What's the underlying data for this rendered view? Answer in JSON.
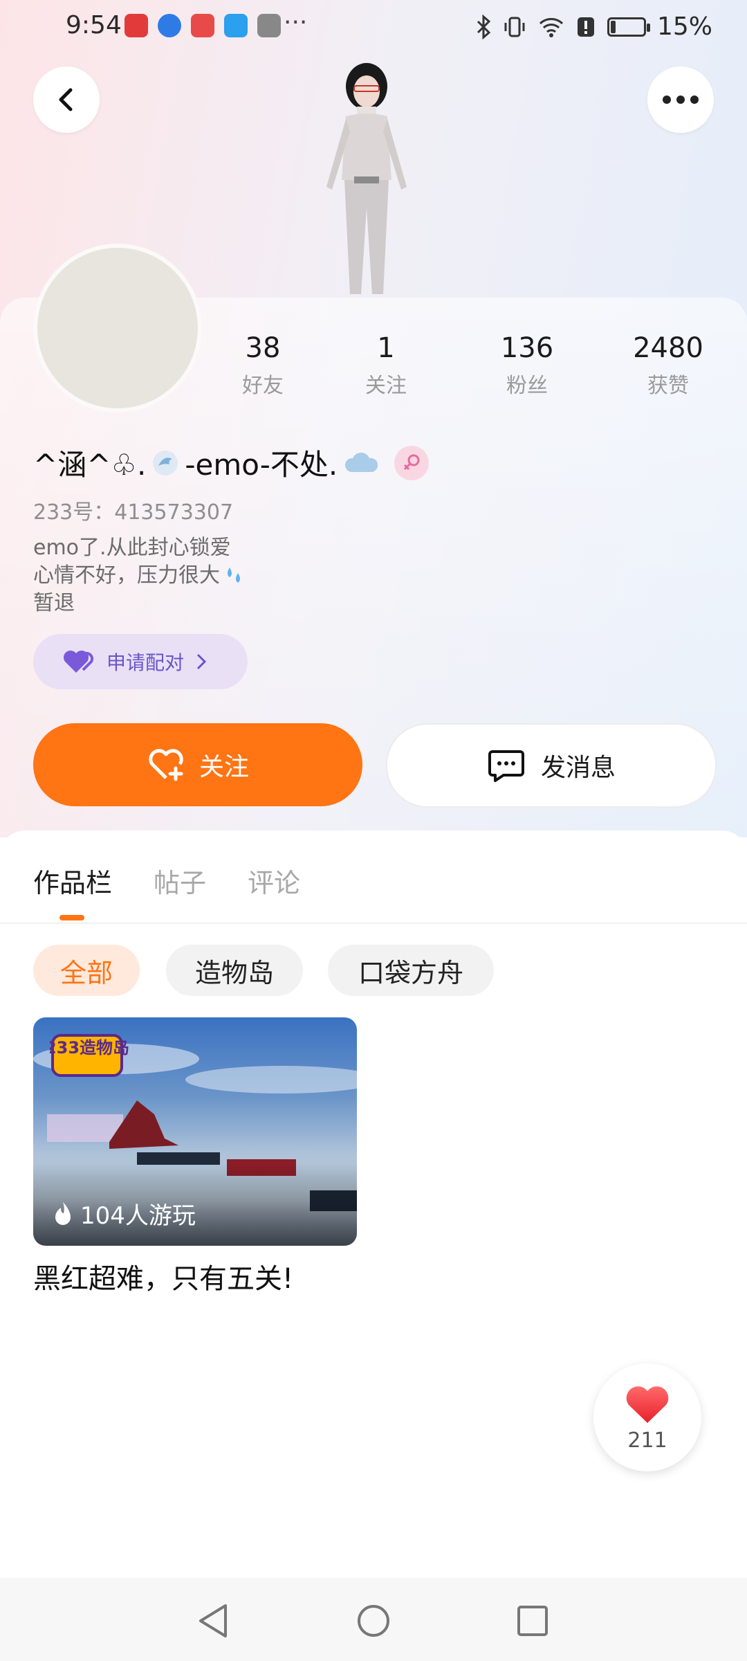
{
  "status_bar": {
    "time": "9:54",
    "dots": "···",
    "battery": "15%",
    "battery_level": 0.15
  },
  "profile": {
    "stats": [
      {
        "value": "38",
        "label": "好友"
      },
      {
        "value": "1",
        "label": "关注"
      },
      {
        "value": "136",
        "label": "粉丝"
      },
      {
        "value": "2480",
        "label": "获赞"
      }
    ],
    "username_a": "^涵^♧.",
    "username_b": "-emo-不处.",
    "uid": "233号：413573307",
    "bio": [
      "emo了.从此封心锁爱",
      "心情不好，压力很大",
      "暂退"
    ],
    "pair_label": "申请配对",
    "follow_label": "关注",
    "message_label": "发消息"
  },
  "tabs": [
    {
      "label": "作品栏",
      "active": true
    },
    {
      "label": "帖子",
      "active": false
    },
    {
      "label": "评论",
      "active": false
    }
  ],
  "filters": [
    {
      "label": "全部",
      "active": true
    },
    {
      "label": "造物岛",
      "active": false
    },
    {
      "label": "口袋方舟",
      "active": false
    }
  ],
  "works": [
    {
      "logo_text": "233造物岛",
      "plays": "104人游玩",
      "title": "黑红超难，只有五关!"
    }
  ],
  "like_fab": {
    "count": "211"
  },
  "colors": {
    "accent": "#ff7413",
    "pair_text": "#6a55c8",
    "gender_pink": "#e56b9b"
  },
  "icons": [
    "back-icon",
    "more-icon",
    "heart-plus-icon",
    "chat-bubble-icon",
    "heart-icon",
    "chevron-right-icon",
    "fire-icon",
    "female-icon"
  ]
}
